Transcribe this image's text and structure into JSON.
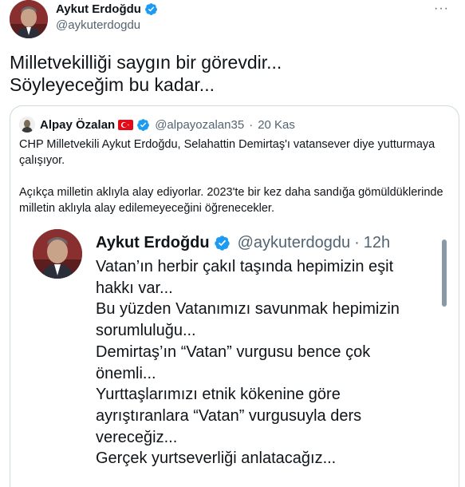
{
  "author": {
    "name": "Aykut Erdoğdu",
    "handle": "@aykuterdogdu"
  },
  "more_label": "···",
  "tweet": {
    "lines": [
      "Milletvekilliği saygın bir görevdir...",
      "Söyleyeceğim bu kadar..."
    ]
  },
  "quote": {
    "name": "Alpay Özalan",
    "handle": "@alpayozalan35",
    "separator": "·",
    "date": "20 Kas",
    "paragraph1": "CHP Milletvekili Aykut Erdoğdu, Selahattin Demirtaş'ı vatansever diye yutturmaya çalışıyor.",
    "paragraph2": "Açıkça milletin aklıyla alay ediyorlar. 2023'te bir kez daha sandığa gömüldüklerinde milletin aklıyla alay edilemeyeceğini öğrenecekler."
  },
  "screenshot": {
    "name": "Aykut Erdoğdu",
    "handle": "@aykuterdogdu",
    "separator": "·",
    "time": "12h",
    "lines": [
      "Vatan’ın herbir çakıl taşında hepimizin eşit",
      "hakkı var...",
      "Bu yüzden Vatanımızı savunmak hepimizin",
      "sorumluluğu...",
      "Demirtaş’ın “Vatan” vurgusu bence çok",
      "önemli...",
      "Yurttaşlarımızı etnik kökenine göre",
      "ayrıştıranlara “Vatan” vurgusuyla ders",
      "vereceğiz...",
      "Gerçek yurtseverliği anlatacağız..."
    ]
  },
  "colors": {
    "verified": "#1d9bf0",
    "secondary_text": "#536471",
    "border": "#cfd9de",
    "flag_red": "#e30a17"
  },
  "icons": [
    "verified-badge-icon",
    "more-icon",
    "turkey-flag-icon"
  ]
}
